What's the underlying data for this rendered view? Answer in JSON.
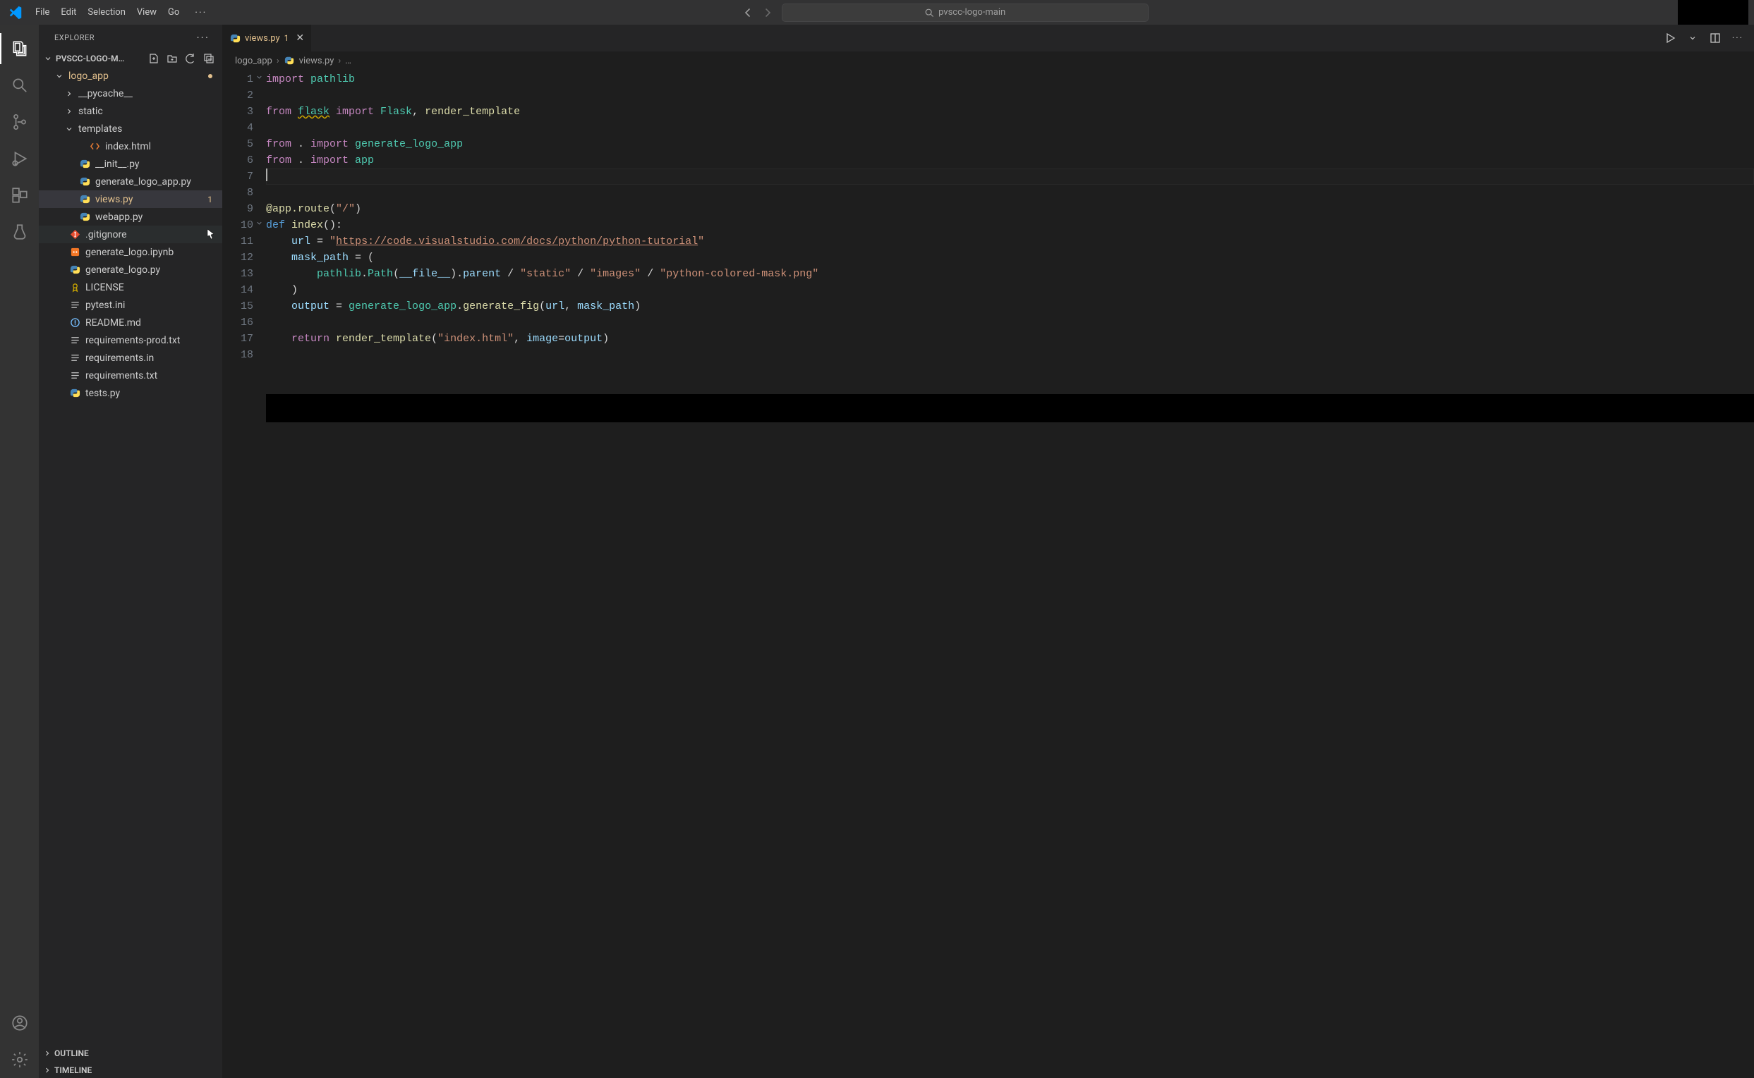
{
  "menu": {
    "items": [
      "File",
      "Edit",
      "Selection",
      "View",
      "Go"
    ],
    "ellipsis": "···"
  },
  "commandCenter": {
    "text": "pvscc-logo-main"
  },
  "sidebar": {
    "title": "EXPLORER",
    "ellipsis": "···",
    "folderTitle": "PVSCC-LOGO-M…",
    "outline": "OUTLINE",
    "timeline": "TIMELINE"
  },
  "tree": {
    "nodes": [
      {
        "label": "logo_app",
        "kind": "folder",
        "state": "open",
        "depth": 1,
        "modified": true,
        "dot": true
      },
      {
        "label": "__pycache__",
        "kind": "folder",
        "state": "closed",
        "depth": 2
      },
      {
        "label": "static",
        "kind": "folder",
        "state": "closed",
        "depth": 2
      },
      {
        "label": "templates",
        "kind": "folder",
        "state": "open",
        "depth": 2
      },
      {
        "label": "index.html",
        "kind": "html",
        "depth": 3
      },
      {
        "label": "__init__.py",
        "kind": "py",
        "depth": 2
      },
      {
        "label": "generate_logo_app.py",
        "kind": "py",
        "depth": 2
      },
      {
        "label": "views.py",
        "kind": "py",
        "depth": 2,
        "modified": true,
        "selected": true,
        "badge": "1"
      },
      {
        "label": "webapp.py",
        "kind": "py",
        "depth": 2
      },
      {
        "label": ".gitignore",
        "kind": "git",
        "depth": 1,
        "hovered": true
      },
      {
        "label": "generate_logo.ipynb",
        "kind": "nb",
        "depth": 1
      },
      {
        "label": "generate_logo.py",
        "kind": "py",
        "depth": 1
      },
      {
        "label": "LICENSE",
        "kind": "lic",
        "depth": 1
      },
      {
        "label": "pytest.ini",
        "kind": "ini",
        "depth": 1
      },
      {
        "label": "README.md",
        "kind": "md",
        "depth": 1
      },
      {
        "label": "requirements-prod.txt",
        "kind": "txt",
        "depth": 1
      },
      {
        "label": "requirements.in",
        "kind": "txt",
        "depth": 1
      },
      {
        "label": "requirements.txt",
        "kind": "txt",
        "depth": 1
      },
      {
        "label": "tests.py",
        "kind": "py",
        "depth": 1
      }
    ]
  },
  "tab": {
    "label": "views.py",
    "badge": "1"
  },
  "breadcrumbs": {
    "seg1": "logo_app",
    "seg2": "views.py",
    "seg3": "…"
  },
  "code": {
    "lineCount": 18,
    "currentLine": 7,
    "lines": [
      [
        {
          "t": "import ",
          "c": "kw"
        },
        {
          "t": "pathlib",
          "c": "mod"
        }
      ],
      [],
      [
        {
          "t": "from ",
          "c": "kw"
        },
        {
          "t": "flask",
          "c": "warn"
        },
        {
          "t": " import ",
          "c": "kw"
        },
        {
          "t": "Flask",
          "c": "mod"
        },
        {
          "t": ", ",
          "c": "punc"
        },
        {
          "t": "render_template",
          "c": "func"
        }
      ],
      [],
      [
        {
          "t": "from ",
          "c": "kw"
        },
        {
          "t": ". ",
          "c": "punc"
        },
        {
          "t": "import ",
          "c": "kw"
        },
        {
          "t": "generate_logo_app",
          "c": "mod"
        }
      ],
      [
        {
          "t": "from ",
          "c": "kw"
        },
        {
          "t": ". ",
          "c": "punc"
        },
        {
          "t": "import ",
          "c": "kw"
        },
        {
          "t": "app",
          "c": "mod"
        }
      ],
      [],
      [],
      [
        {
          "t": "@app.route",
          "c": "dec"
        },
        {
          "t": "(",
          "c": "punc"
        },
        {
          "t": "\"/\"",
          "c": "str"
        },
        {
          "t": ")",
          "c": "punc"
        }
      ],
      [
        {
          "t": "def ",
          "c": "def"
        },
        {
          "t": "index",
          "c": "func"
        },
        {
          "t": "():",
          "c": "punc"
        }
      ],
      [
        {
          "t": "    ",
          "c": "punc"
        },
        {
          "t": "url",
          "c": "var"
        },
        {
          "t": " = ",
          "c": "punc"
        },
        {
          "t": "\"",
          "c": "str"
        },
        {
          "t": "https://code.visualstudio.com/docs/python/python-tutorial",
          "c": "url"
        },
        {
          "t": "\"",
          "c": "str"
        }
      ],
      [
        {
          "t": "    ",
          "c": "punc"
        },
        {
          "t": "mask_path",
          "c": "var"
        },
        {
          "t": " = (",
          "c": "punc"
        }
      ],
      [
        {
          "t": "        ",
          "c": "punc"
        },
        {
          "t": "pathlib",
          "c": "mod"
        },
        {
          "t": ".",
          "c": "punc"
        },
        {
          "t": "Path",
          "c": "mod"
        },
        {
          "t": "(",
          "c": "punc"
        },
        {
          "t": "__file__",
          "c": "const"
        },
        {
          "t": ").",
          "c": "punc"
        },
        {
          "t": "parent",
          "c": "var"
        },
        {
          "t": " / ",
          "c": "punc"
        },
        {
          "t": "\"static\"",
          "c": "str"
        },
        {
          "t": " / ",
          "c": "punc"
        },
        {
          "t": "\"images\"",
          "c": "str"
        },
        {
          "t": " / ",
          "c": "punc"
        },
        {
          "t": "\"python-colored-mask.png\"",
          "c": "str"
        }
      ],
      [
        {
          "t": "    )",
          "c": "punc"
        }
      ],
      [
        {
          "t": "    ",
          "c": "punc"
        },
        {
          "t": "output",
          "c": "var"
        },
        {
          "t": " = ",
          "c": "punc"
        },
        {
          "t": "generate_logo_app",
          "c": "mod"
        },
        {
          "t": ".",
          "c": "punc"
        },
        {
          "t": "generate_fig",
          "c": "func"
        },
        {
          "t": "(",
          "c": "punc"
        },
        {
          "t": "url",
          "c": "var"
        },
        {
          "t": ", ",
          "c": "punc"
        },
        {
          "t": "mask_path",
          "c": "var"
        },
        {
          "t": ")",
          "c": "punc"
        }
      ],
      [],
      [
        {
          "t": "    ",
          "c": "punc"
        },
        {
          "t": "return ",
          "c": "kw"
        },
        {
          "t": "render_template",
          "c": "func"
        },
        {
          "t": "(",
          "c": "punc"
        },
        {
          "t": "\"index.html\"",
          "c": "str"
        },
        {
          "t": ", ",
          "c": "punc"
        },
        {
          "t": "image",
          "c": "param"
        },
        {
          "t": "=",
          "c": "punc"
        },
        {
          "t": "output",
          "c": "var"
        },
        {
          "t": ")",
          "c": "punc"
        }
      ],
      []
    ],
    "folds": {
      "1": true,
      "10": true
    }
  }
}
